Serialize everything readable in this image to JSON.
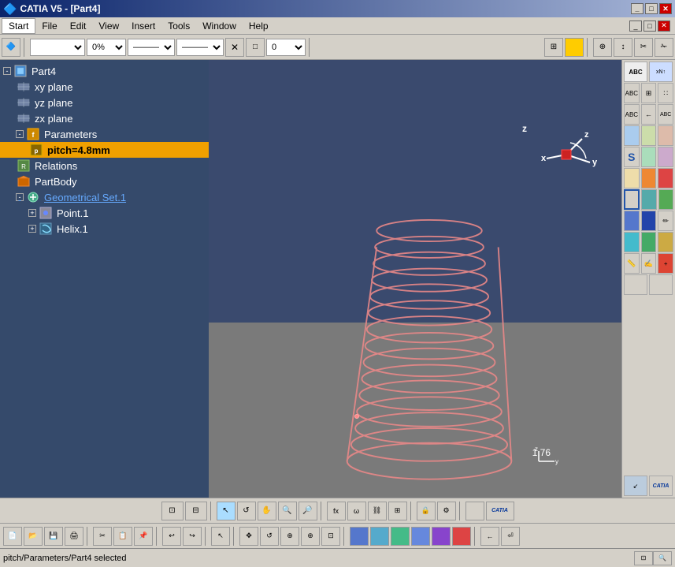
{
  "titlebar": {
    "title": "CATIA V5 - [Part4]",
    "icon": "catia-icon",
    "controls": [
      "minimize",
      "maximize",
      "close"
    ]
  },
  "menubar": {
    "items": [
      "Start",
      "File",
      "Edit",
      "View",
      "Insert",
      "Tools",
      "Window",
      "Help"
    ]
  },
  "toolbar1": {
    "dropdowns": [
      "",
      "0%",
      "",
      ""
    ],
    "buttons": [
      "X",
      "□"
    ]
  },
  "tree": {
    "root": "Part4",
    "items": [
      {
        "id": "part4",
        "label": "Part4",
        "level": 0,
        "icon": "part-icon",
        "expanded": true
      },
      {
        "id": "xyplane",
        "label": "xy plane",
        "level": 1,
        "icon": "plane-icon"
      },
      {
        "id": "yzplane",
        "label": "yz plane",
        "level": 1,
        "icon": "plane-icon"
      },
      {
        "id": "zxplane",
        "label": "zx plane",
        "level": 1,
        "icon": "plane-icon"
      },
      {
        "id": "parameters",
        "label": "Parameters",
        "level": 1,
        "icon": "param-icon",
        "expanded": true
      },
      {
        "id": "pitch",
        "label": "pitch=4.8mm",
        "level": 2,
        "icon": "param-value-icon",
        "highlighted": true
      },
      {
        "id": "relations",
        "label": "Relations",
        "level": 1,
        "icon": "rel-icon"
      },
      {
        "id": "partbody",
        "label": "PartBody",
        "level": 1,
        "icon": "body-icon"
      },
      {
        "id": "geoset1",
        "label": "Geometrical Set.1",
        "level": 1,
        "icon": "gset-icon",
        "expanded": true,
        "active": true
      },
      {
        "id": "point1",
        "label": "Point.1",
        "level": 2,
        "icon": "point-icon"
      },
      {
        "id": "helix1",
        "label": "Helix.1",
        "level": 2,
        "icon": "helix-icon"
      }
    ]
  },
  "viewport": {
    "background_top": "#3a4a6e",
    "background_bottom": "#7a7a7a",
    "measure": "1.76",
    "coords": {
      "x": "x",
      "y": "y",
      "z": "z"
    }
  },
  "statusbar": {
    "text": "pitch/Parameters/Part4 selected"
  },
  "bottom_toolbar": {
    "buttons": [
      "snap1",
      "snap2",
      "cursor",
      "rotate",
      "pan",
      "zoomin",
      "zoomout",
      "fit",
      "b1",
      "b2",
      "b3",
      "b4",
      "b5"
    ]
  }
}
